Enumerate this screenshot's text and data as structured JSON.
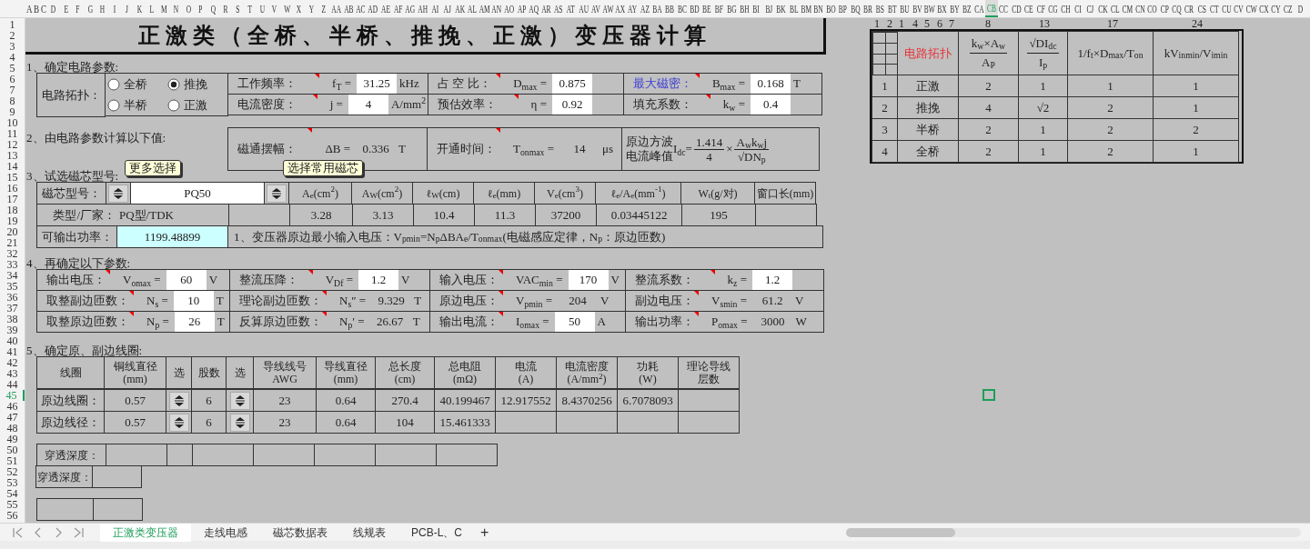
{
  "column_headers": [
    {
      "label": "A",
      "selected": false
    },
    {
      "label": "B",
      "selected": false
    },
    {
      "label": "C",
      "selected": false
    },
    {
      "label": "D",
      "selected": false
    },
    {
      "label": "E",
      "selected": false
    },
    {
      "label": "F",
      "selected": false
    },
    {
      "label": "G",
      "selected": false
    },
    {
      "label": "H",
      "selected": false
    },
    {
      "label": "I",
      "selected": false
    },
    {
      "label": "J",
      "selected": false
    },
    {
      "label": "K",
      "selected": false
    },
    {
      "label": "L",
      "selected": false
    },
    {
      "label": "M",
      "selected": false
    },
    {
      "label": "N",
      "selected": false
    },
    {
      "label": "O",
      "selected": false
    },
    {
      "label": "P",
      "selected": false
    },
    {
      "label": "Q",
      "selected": false
    },
    {
      "label": "R",
      "selected": false
    },
    {
      "label": "S",
      "selected": false
    },
    {
      "label": "T",
      "selected": false
    },
    {
      "label": "U",
      "selected": false
    },
    {
      "label": "V",
      "selected": false
    },
    {
      "label": "W",
      "selected": false
    },
    {
      "label": "X",
      "selected": false
    },
    {
      "label": "Y",
      "selected": false
    },
    {
      "label": "Z",
      "selected": false
    },
    {
      "label": "AA",
      "selected": false
    },
    {
      "label": "AB",
      "selected": false
    },
    {
      "label": "AC",
      "selected": false
    },
    {
      "label": "AD",
      "selected": false
    },
    {
      "label": "AE",
      "selected": false
    },
    {
      "label": "AF",
      "selected": false
    },
    {
      "label": "AG",
      "selected": false
    },
    {
      "label": "AH",
      "selected": false
    },
    {
      "label": "AI",
      "selected": false
    },
    {
      "label": "AJ",
      "selected": false
    },
    {
      "label": "AK",
      "selected": false
    },
    {
      "label": "AL",
      "selected": false
    },
    {
      "label": "AM",
      "selected": false
    },
    {
      "label": "AN",
      "selected": false
    },
    {
      "label": "AO",
      "selected": false
    },
    {
      "label": "AP",
      "selected": false
    },
    {
      "label": "AQ",
      "selected": false
    },
    {
      "label": "AR",
      "selected": false
    },
    {
      "label": "AS",
      "selected": false
    },
    {
      "label": "AT",
      "selected": false
    },
    {
      "label": "AU",
      "selected": false
    },
    {
      "label": "AV",
      "selected": false
    },
    {
      "label": "AW",
      "selected": false
    },
    {
      "label": "AX",
      "selected": false
    },
    {
      "label": "AY",
      "selected": false
    },
    {
      "label": "AZ",
      "selected": false
    },
    {
      "label": "BA",
      "selected": false
    },
    {
      "label": "BB",
      "selected": false
    },
    {
      "label": "BC",
      "selected": false
    },
    {
      "label": "BD",
      "selected": false
    },
    {
      "label": "BE",
      "selected": false
    },
    {
      "label": "BF",
      "selected": false
    },
    {
      "label": "BG",
      "selected": false
    },
    {
      "label": "BH",
      "selected": false
    },
    {
      "label": "BI",
      "selected": false
    },
    {
      "label": "BJ",
      "selected": false
    },
    {
      "label": "BK",
      "selected": false
    },
    {
      "label": "BL",
      "selected": false
    },
    {
      "label": "BM",
      "selected": false
    },
    {
      "label": "BN",
      "selected": false
    },
    {
      "label": "BO",
      "selected": false
    },
    {
      "label": "BP",
      "selected": false
    },
    {
      "label": "BQ",
      "selected": false
    },
    {
      "label": "BR",
      "selected": false
    },
    {
      "label": "BS",
      "selected": false
    },
    {
      "label": "BT",
      "selected": false
    },
    {
      "label": "BU",
      "selected": false
    },
    {
      "label": "BV",
      "selected": false
    },
    {
      "label": "BW",
      "selected": false
    },
    {
      "label": "BX",
      "selected": false
    },
    {
      "label": "BY",
      "selected": false
    },
    {
      "label": "BZ",
      "selected": false
    },
    {
      "label": "CA",
      "selected": false
    },
    {
      "label": "CB",
      "selected": true
    },
    {
      "label": "CC",
      "selected": false
    },
    {
      "label": "CD",
      "selected": false
    },
    {
      "label": "CE",
      "selected": false
    },
    {
      "label": "CF",
      "selected": false
    },
    {
      "label": "CG",
      "selected": false
    },
    {
      "label": "CH",
      "selected": false
    },
    {
      "label": "CI",
      "selected": false
    },
    {
      "label": "CJ",
      "selected": false
    },
    {
      "label": "CK",
      "selected": false
    },
    {
      "label": "CL",
      "selected": false
    },
    {
      "label": "CM",
      "selected": false
    },
    {
      "label": "CN",
      "selected": false
    },
    {
      "label": "CO",
      "selected": false
    },
    {
      "label": "CP",
      "selected": false
    },
    {
      "label": "CQ",
      "selected": false
    },
    {
      "label": "CR",
      "selected": false
    },
    {
      "label": "CS",
      "selected": false
    },
    {
      "label": "CT",
      "selected": false
    },
    {
      "label": "CU",
      "selected": false
    },
    {
      "label": "CV",
      "selected": false
    },
    {
      "label": "CW",
      "selected": false
    },
    {
      "label": "CX",
      "selected": false
    },
    {
      "label": "CY",
      "selected": false
    },
    {
      "label": "CZ",
      "selected": false
    },
    {
      "label": "D",
      "selected": false
    }
  ],
  "row_headers": [
    {
      "label": "1",
      "selected": false
    },
    {
      "label": "2",
      "selected": false
    },
    {
      "label": "3",
      "selected": false
    },
    {
      "label": "4",
      "selected": false
    },
    {
      "label": "5",
      "selected": false
    },
    {
      "label": "6",
      "selected": false
    },
    {
      "label": "7",
      "selected": false
    },
    {
      "label": "8",
      "selected": false
    },
    {
      "label": "9",
      "selected": false
    },
    {
      "label": "10",
      "selected": false
    },
    {
      "label": "11",
      "selected": false
    },
    {
      "label": "12",
      "selected": false
    },
    {
      "label": "13",
      "selected": false
    },
    {
      "label": "14",
      "selected": false
    },
    {
      "label": "15",
      "selected": false
    },
    {
      "label": "16",
      "selected": false
    },
    {
      "label": "17",
      "selected": false
    },
    {
      "label": "18",
      "selected": false
    },
    {
      "label": "19",
      "selected": false
    },
    {
      "label": "20",
      "selected": false
    },
    {
      "label": "21",
      "selected": false
    },
    {
      "label": "32",
      "selected": false
    },
    {
      "label": "33",
      "selected": false
    },
    {
      "label": "34",
      "selected": false
    },
    {
      "label": "35",
      "selected": false
    },
    {
      "label": "36",
      "selected": false
    },
    {
      "label": "37",
      "selected": false
    },
    {
      "label": "38",
      "selected": false
    },
    {
      "label": "39",
      "selected": false
    },
    {
      "label": "40",
      "selected": false
    },
    {
      "label": "41",
      "selected": false
    },
    {
      "label": "42",
      "selected": false
    },
    {
      "label": "43",
      "selected": false
    },
    {
      "label": "44",
      "selected": false
    },
    {
      "label": "45",
      "selected": true
    },
    {
      "label": "46",
      "selected": false
    },
    {
      "label": "47",
      "selected": false
    },
    {
      "label": "48",
      "selected": false
    },
    {
      "label": "49",
      "selected": false
    },
    {
      "label": "50",
      "selected": false
    },
    {
      "label": "51",
      "selected": false
    },
    {
      "label": "52",
      "selected": false
    },
    {
      "label": "53",
      "selected": false
    },
    {
      "label": "54",
      "selected": false
    },
    {
      "label": "55",
      "selected": false
    },
    {
      "label": "56",
      "selected": false
    }
  ],
  "title": "正激类（全桥、半桥、推挽、正激）变压器计算",
  "section1": {
    "heading": "1、确定电路参数:",
    "topology_label": "电路拓扑：",
    "options": [
      {
        "label": "全桥",
        "selected": false
      },
      {
        "label": "推挽",
        "selected": true
      },
      {
        "label": "半桥",
        "selected": false
      },
      {
        "label": "正激",
        "selected": false
      }
    ],
    "rows": [
      [
        {
          "label": "工作频率：",
          "symbol": "f$_{T}$ =",
          "kind": "input",
          "value": "31.25",
          "unit": "kHz",
          "commented": true
        },
        {
          "label": "占 空 比：",
          "symbol": "D$_{max}$ =",
          "kind": "input",
          "value": "0.875",
          "commented": true
        },
        {
          "label": "最大磁密：",
          "color": "#3b3bd6",
          "symbol": "B$_{max}$ =",
          "kind": "input",
          "value": "0.168",
          "unit": "T",
          "commented": true
        }
      ],
      [
        {
          "label": "电流密度：",
          "symbol": "j =",
          "kind": "input",
          "value": "4",
          "unit": "A/mm$^{2}$",
          "commented": true
        },
        {
          "label": "预估效率：",
          "symbol": "η =",
          "kind": "input",
          "value": "0.92",
          "commented": true
        },
        {
          "label": "填充系数：",
          "symbol": "k$_{w}$ =",
          "kind": "input",
          "value": "0.4",
          "commented": true
        }
      ]
    ]
  },
  "section2": {
    "heading": "2、由电路参数计算以下值:",
    "items": [
      {
        "label": "磁通摆幅：",
        "symbol": "ΔB =",
        "kind": "output",
        "value": "0.336",
        "unit": "T",
        "commented": true
      },
      {
        "label": "开通时间：",
        "symbol": "T$_{onmax}$ =",
        "kind": "output",
        "value": "14",
        "unit": "μs",
        "commented": true
      }
    ],
    "formula": {
      "label": "原边方波电流峰值",
      "symbol": "I$_{dc}$=",
      "numerator": "1.414",
      "denominator": "4",
      "times": "×",
      "numerator_2": "A$_{w}$k$_{w}$j",
      "denominator_2": "√DN$_{p}$"
    }
  },
  "section3": {
    "heading": "3、试选磁芯型号:",
    "callouts": [
      "更多选择",
      "选择常用磁芯"
    ],
    "core_label": "磁芯型号：",
    "core_value": "PQ50",
    "headers": [
      "A$_{e}$(cm$^{2}$)",
      "A$_{W}$(cm$^{2}$)",
      "ℓ$_{W}$(cm)",
      "ℓ$_{e}$(mm)",
      "V$_{e}$(cm$^{3}$)",
      "ℓ$_{e}$/A$_{e}$(mm$^{-1}$)",
      "W$_{t}$(g/对)",
      "窗口长(mm)"
    ],
    "type_label": "类型/厂家：",
    "type_value": "PQ型/TDK",
    "values": [
      "3.28",
      "3.13",
      "10.4",
      "11.3",
      "37200",
      "0.03445122",
      "195"
    ],
    "power_label": "可输出功率：",
    "power_value": "1199.48899",
    "note": "1、变压器原边最小输入电压：V$_{pmin}$=N$_{p}$ΔBA$_{e}$/T$_{onmax}$(电磁感应定律，N$_{p}$：原边匝数)"
  },
  "section4": {
    "heading": "4、再确定以下参数:",
    "rows": [
      [
        {
          "label": "输出电压：",
          "symbol": "V$_{omax}$ =",
          "kind": "input",
          "value": "60",
          "unit": "V",
          "commented": true
        },
        {
          "label": "整流压降：",
          "symbol": "V$_{Df}$ =",
          "kind": "input",
          "value": "1.2",
          "unit": "V",
          "commented": true
        },
        {
          "label": "输入电压：",
          "symbol": "VAC$_{min}$ =",
          "kind": "input",
          "value": "170",
          "unit": "V",
          "commented": true
        },
        {
          "label": "整流系数：",
          "symbol": "k$_{z}$ =",
          "kind": "input",
          "value": "1.2",
          "commented": true
        }
      ],
      [
        {
          "label": "取整副边匝数：",
          "symbol": "N$_{s}$ =",
          "kind": "input",
          "value": "10",
          "unit": "T",
          "commented": true
        },
        {
          "label": "理论副边匝数：",
          "symbol": "N$_{s}$″ =",
          "kind": "output",
          "value": "9.329",
          "unit": "T",
          "commented": true
        },
        {
          "label": "原边电压：",
          "symbol": "V$_{pmin}$ =",
          "kind": "output",
          "value": "204",
          "unit": "V",
          "commented": true
        },
        {
          "label": "副边电压：",
          "symbol": "V$_{smin}$ =",
          "kind": "output",
          "value": "61.2",
          "unit": "V",
          "commented": true
        }
      ],
      [
        {
          "label": "取整原边匝数：",
          "symbol": "N$_{p}$ =",
          "kind": "input",
          "value": "26",
          "unit": "T",
          "commented": true
        },
        {
          "label": "反算原边匝数：",
          "symbol": "N$_{p}$′ =",
          "kind": "output",
          "value": "26.67",
          "unit": "T",
          "commented": true
        },
        {
          "label": "输出电流：",
          "symbol": "I$_{omax}$ =",
          "kind": "input",
          "value": "50",
          "unit": "A",
          "commented": true
        },
        {
          "label": "输出功率：",
          "symbol": "P$_{omax}$ =",
          "kind": "output",
          "value": "3000",
          "unit": "W",
          "commented": true
        }
      ]
    ]
  },
  "section5": {
    "heading": "5、确定原、副边线圈:",
    "columns": [
      {
        "title": "线圈"
      },
      {
        "title": "铜线直径",
        "unit": "(mm)"
      },
      {
        "title": "选"
      },
      {
        "title": "股数"
      },
      {
        "title": "选"
      },
      {
        "title": "导线线号",
        "unit": "AWG"
      },
      {
        "title": "导线直径",
        "unit": "(mm)"
      },
      {
        "title": "总长度",
        "unit": "(cm)"
      },
      {
        "title": "总电阻",
        "unit": "(mΩ)"
      },
      {
        "title": "电流",
        "unit": "(A)"
      },
      {
        "title": "电流密度",
        "unit": "(A/mm$^{2}$)"
      },
      {
        "title": "功耗",
        "unit": "(W)"
      },
      {
        "title": "理论导线层数"
      }
    ],
    "rows": [
      {
        "cells": [
          {
            "kind": "text",
            "text": "原边线圈："
          },
          {
            "kind": "text",
            "text": "0.57"
          },
          {
            "kind": "spinner"
          },
          {
            "kind": "text",
            "text": "6"
          },
          {
            "kind": "spinner"
          },
          {
            "kind": "text",
            "text": "23"
          },
          {
            "kind": "text",
            "text": "0.64"
          },
          {
            "kind": "text",
            "text": "270.4"
          },
          {
            "kind": "text",
            "text": "40.199467"
          },
          {
            "kind": "text",
            "text": "12.917552"
          },
          {
            "kind": "text",
            "text": "8.4370256"
          },
          {
            "kind": "text",
            "text": "6.7078093"
          },
          {
            "kind": "empty"
          }
        ]
      },
      {
        "cells": [
          {
            "kind": "text",
            "text": "原边线径："
          },
          {
            "kind": "text",
            "text": "0.57"
          },
          {
            "kind": "spinner"
          },
          {
            "kind": "text",
            "text": "6"
          },
          {
            "kind": "spinner"
          },
          {
            "kind": "text",
            "text": "23"
          },
          {
            "kind": "text",
            "text": "0.64"
          },
          {
            "kind": "text",
            "text": "104"
          },
          {
            "kind": "text",
            "text": "15.461333"
          },
          {
            "kind": "empty"
          },
          {
            "kind": "empty"
          },
          {
            "kind": "empty"
          },
          {
            "kind": "empty"
          }
        ]
      }
    ],
    "penetration": [
      {
        "label": "穿透深度："
      },
      {
        "label": "穿透深度："
      }
    ]
  },
  "reference_table": {
    "column_numbers": [
      "1",
      "2",
      "1",
      "4",
      "5",
      "6",
      "7",
      "8",
      "13",
      "17",
      "24"
    ],
    "headers": [
      {
        "kind": "grid"
      },
      {
        "kind": "text",
        "text": "电路拓扑",
        "color": "#e8333a"
      },
      {
        "kind": "fraction",
        "numerator": "k$_{w}$×A$_{w}$",
        "denominator": "A$_{P}$"
      },
      {
        "kind": "fraction",
        "numerator": "√DI$_{dc}$",
        "denominator": "I$_{p}$"
      },
      {
        "kind": "text",
        "text": "1/f$_{t}$×D$_{max}$/T$_{on}$"
      },
      {
        "kind": "text",
        "text": "kV$_{inmin}$/V$_{imin}$"
      }
    ],
    "rows": [
      [
        "1",
        "正激",
        "2",
        "1",
        "1",
        "1"
      ],
      [
        "2",
        "推挽",
        "4",
        "√2",
        "2",
        "1"
      ],
      [
        "3",
        "半桥",
        "2",
        "1",
        "2",
        "2"
      ],
      [
        "4",
        "全桥",
        "2",
        "1",
        "2",
        "1"
      ]
    ]
  },
  "sheet_tabs": [
    {
      "label": "正激类变压器",
      "selected": true
    },
    {
      "label": "走线电感",
      "selected": false
    },
    {
      "label": "磁芯数据表",
      "selected": false
    },
    {
      "label": "线规表",
      "selected": false
    },
    {
      "label": "PCB-L、C",
      "selected": false
    }
  ],
  "add_tab": "+"
}
